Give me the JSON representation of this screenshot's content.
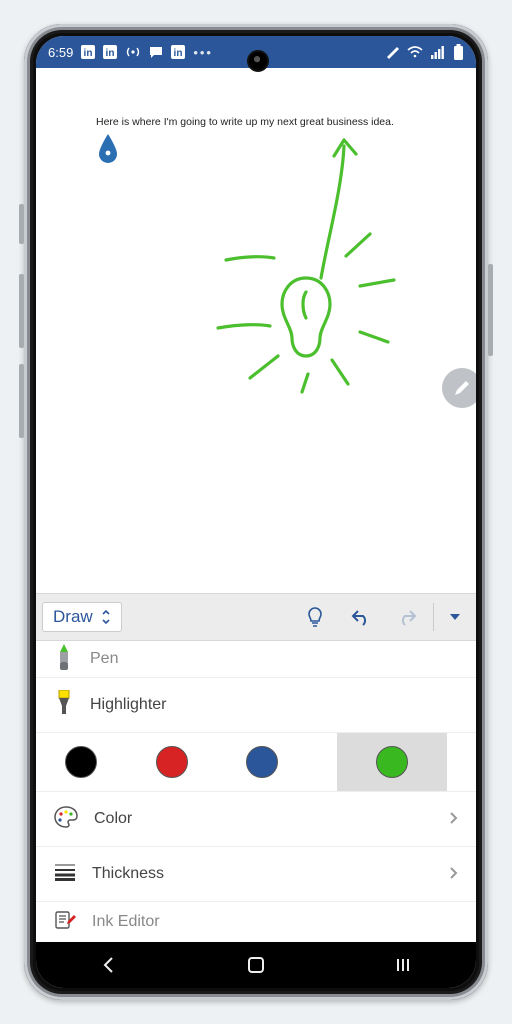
{
  "status": {
    "time": "6:59",
    "dots": "•••"
  },
  "document": {
    "text": "Here is where I'm going to write up my next great business idea."
  },
  "toolbar": {
    "tab": "Draw"
  },
  "options": {
    "pen": "Pen",
    "highlighter": "Highlighter",
    "color": "Color",
    "thickness": "Thickness",
    "ink_editor": "Ink Editor"
  },
  "swatches": {
    "black": "#000000",
    "red": "#d72323",
    "blue": "#2b579a",
    "green": "#39b81f",
    "selected": "green"
  }
}
